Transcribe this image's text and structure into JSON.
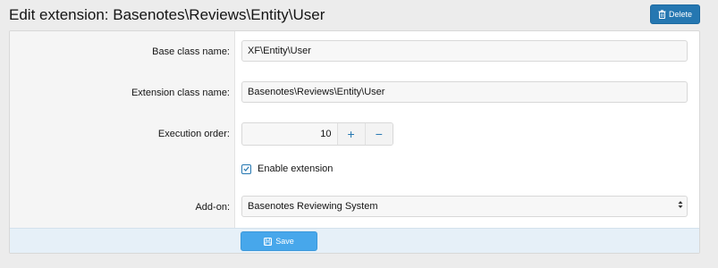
{
  "header": {
    "title": "Edit extension: Basenotes\\Reviews\\Entity\\User",
    "delete_label": "Delete"
  },
  "form": {
    "base_class": {
      "label": "Base class name:",
      "value": "XF\\Entity\\User"
    },
    "extension_class": {
      "label": "Extension class name:",
      "value": "Basenotes\\Reviews\\Entity\\User"
    },
    "execution_order": {
      "label": "Execution order:",
      "value": "10",
      "increment": "+",
      "decrement": "−"
    },
    "enable": {
      "label": "Enable extension",
      "checked": true
    },
    "addon": {
      "label": "Add-on:",
      "selected": "Basenotes Reviewing System"
    }
  },
  "footer": {
    "save_label": "Save"
  },
  "icons": {
    "delete": "trash-icon",
    "save": "save-icon",
    "checkbox": "check-icon",
    "select": "select-arrows-icon"
  },
  "colors": {
    "accent": "#2577b1",
    "save_button": "#47a7eb",
    "footer_bg": "#e6f0f8"
  }
}
